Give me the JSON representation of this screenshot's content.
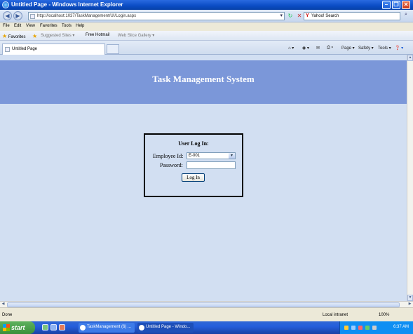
{
  "window": {
    "title": "Untitled Page - Windows Internet Explorer"
  },
  "address": {
    "url": "http://localhost:1037/TaskManagement/UI/Login.aspx"
  },
  "search": {
    "placeholder": "Yahoo! Search"
  },
  "menu": [
    "File",
    "Edit",
    "View",
    "Favorites",
    "Tools",
    "Help"
  ],
  "favorites": {
    "label": "Favorites",
    "items": [
      "Suggested Sites ▾",
      "Free Hotmail",
      "Web Slice Gallery ▾"
    ]
  },
  "tab": {
    "label": "Untitled Page"
  },
  "commandbar": {
    "page": "Page ▾",
    "safety": "Safety ▾",
    "tools": "Tools ▾"
  },
  "page": {
    "site_title": "Task Management System",
    "login": {
      "heading": "User Log In:",
      "employee_label": "Employee Id:",
      "employee_value": "E-001",
      "password_label": "Password:",
      "button": "Log In"
    }
  },
  "status": {
    "left": "Done",
    "zone": "Local intranet",
    "zoom": "100%"
  },
  "taskbar": {
    "start": "start",
    "buttons": [
      "TaskManagement (6) ...",
      "Untitled Page - Windo..."
    ],
    "clock": "6:37 AM"
  }
}
